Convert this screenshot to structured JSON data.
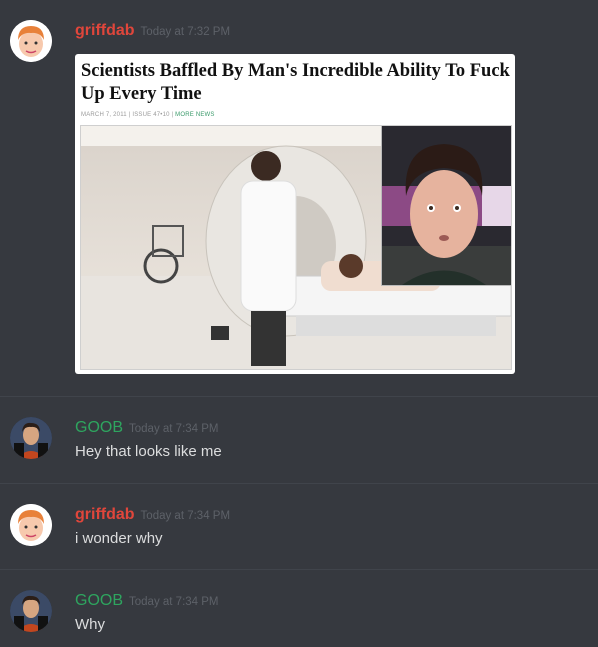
{
  "messages": [
    {
      "author": "griffdab",
      "timestamp": "Today at 7:32 PM",
      "embed": {
        "headline": "Scientists Baffled By Man's Incredible Ability To Fuck Up Every Time",
        "meta": "MARCH 7, 2011 | ISSUE 47•10 |",
        "meta_link": "MORE NEWS"
      }
    },
    {
      "author": "GOOB",
      "timestamp": "Today at 7:34 PM",
      "text": "Hey that looks like me"
    },
    {
      "author": "griffdab",
      "timestamp": "Today at 7:34 PM",
      "text": "i wonder why"
    },
    {
      "author": "GOOB",
      "timestamp": "Today at 7:34 PM",
      "text": "Why"
    }
  ],
  "colors": {
    "background": "#36393f",
    "griffdab_name": "#e0463b",
    "goob_name": "#2ea55f",
    "timestamp": "#5d6168",
    "message_text": "#dcddde"
  },
  "icons": {
    "griffdab_avatar": "cartoon-face-avatar",
    "goob_avatar": "portrait-avatar"
  }
}
